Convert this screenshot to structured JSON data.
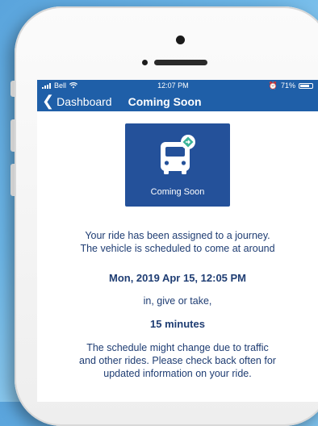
{
  "status_bar": {
    "carrier": "Bell",
    "time": "12:07 PM",
    "battery": "71%"
  },
  "nav": {
    "back_label": "Dashboard",
    "title": "Coming Soon"
  },
  "tile": {
    "label": "Coming Soon",
    "icon": "bus-icon",
    "color": "#24519a"
  },
  "message": {
    "line1": "Your ride has been assigned to a journey.",
    "line2": "The vehicle is scheduled to come at around",
    "datetime": "Mon, 2019 Apr 15, 12:05 PM",
    "give_or_take": "in, give or take,",
    "minutes": "15 minutes",
    "disclaimer1": "The schedule might change due to traffic",
    "disclaimer2": "and other rides. Please check back often for",
    "disclaimer3": "updated information on your ride."
  },
  "colors": {
    "accent": "#1f5fa8",
    "text": "#1f3d73",
    "badge": "#3bb39a"
  }
}
